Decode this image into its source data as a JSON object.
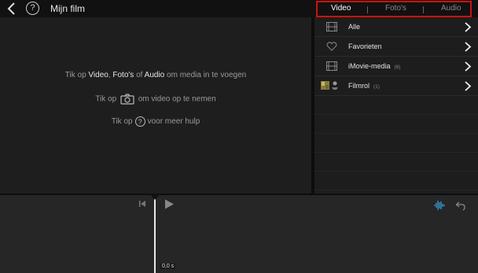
{
  "header": {
    "title": "Mijn film",
    "help_symbol": "?"
  },
  "segmented": {
    "items": [
      {
        "label": "Video",
        "active": true
      },
      {
        "label": "Foto's",
        "active": false
      },
      {
        "label": "Audio",
        "active": false
      }
    ]
  },
  "preview": {
    "line1": {
      "pre": "Tik op ",
      "video": "Video",
      "c1": ", ",
      "photos": "Foto's",
      "of": " of ",
      "audio": "Audio",
      "post": " om media in te voegen"
    },
    "line2": {
      "pre": "Tik op",
      "post": "om video op te nemen"
    },
    "line3": {
      "pre": "Tik op",
      "symbol": "?",
      "post": "voor meer hulp"
    }
  },
  "library": {
    "items": [
      {
        "label": "Alle",
        "count": "",
        "icon": "film-strip-icon"
      },
      {
        "label": "Favorieten",
        "count": "",
        "icon": "heart-icon"
      },
      {
        "label": "iMovie-media",
        "count": "(6)",
        "icon": "film-strip-icon"
      },
      {
        "label": "Filmrol",
        "count": "(1)",
        "icon": "photo-thumbnail-icon"
      }
    ]
  },
  "timeline": {
    "time": "0,0 s"
  },
  "colors": {
    "accent": "#3aa3e3",
    "highlight_border": "#d01010"
  }
}
